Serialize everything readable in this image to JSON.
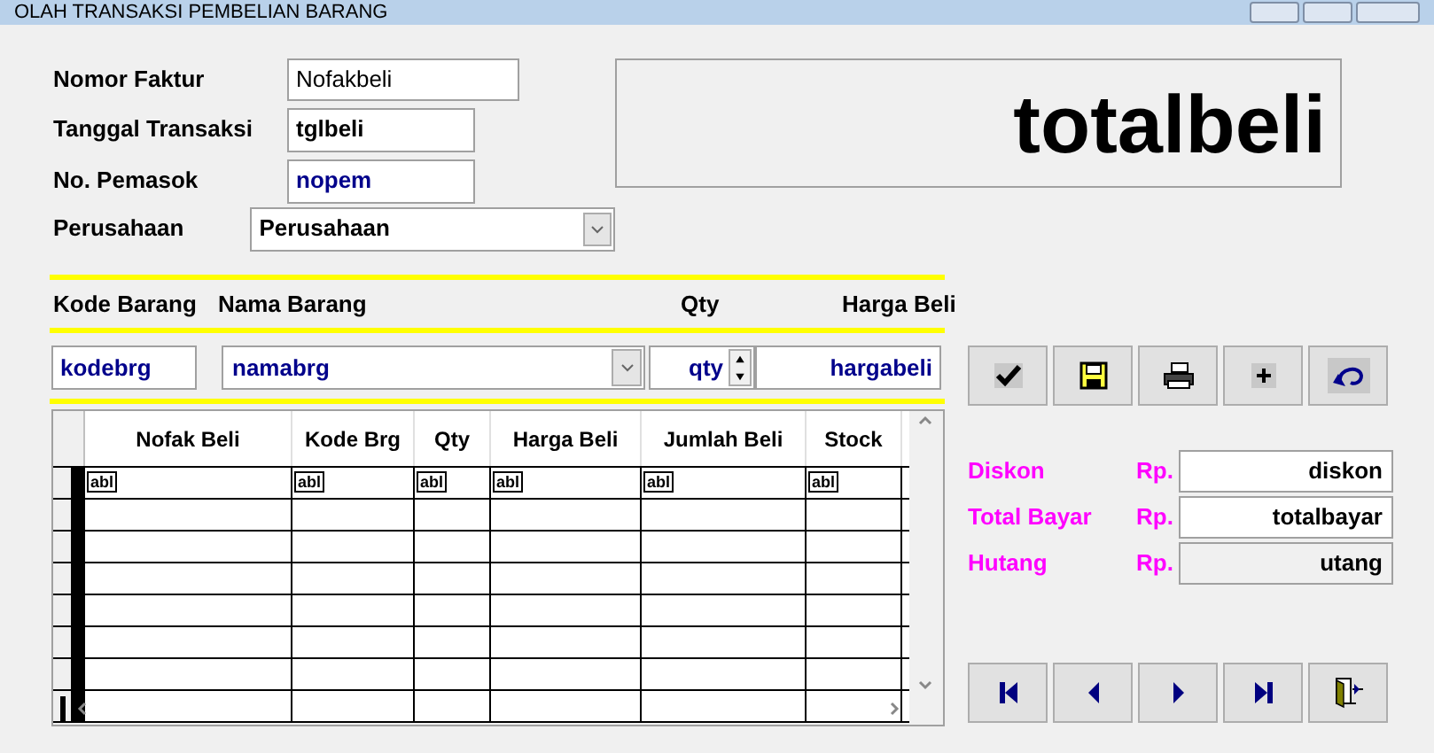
{
  "window": {
    "title": "OLAH TRANSAKSI PEMBELIAN BARANG"
  },
  "header_form": [
    {
      "label": "Nomor Faktur",
      "value": "Nofakbeli",
      "kind": "text"
    },
    {
      "label": "Tanggal Transaksi",
      "value": "tglbeli",
      "kind": "text"
    },
    {
      "label": "No. Pemasok",
      "value": "nopem",
      "kind": "text"
    },
    {
      "label": "Perusahaan",
      "value": "Perusahaan",
      "kind": "combo"
    }
  ],
  "total_display": "totalbeli",
  "item_headers": [
    "Kode Barang",
    "Nama Barang",
    "Qty",
    "Harga Beli"
  ],
  "item_inputs": [
    {
      "value": "kodebrg",
      "kind": "text"
    },
    {
      "value": "namabrg",
      "kind": "combo"
    },
    {
      "value": "qty",
      "kind": "spin"
    },
    {
      "value": "hargabeli",
      "kind": "text"
    }
  ],
  "table": {
    "columns": [
      "Nofak Beli",
      "Kode Brg",
      "Qty",
      "Harga Beli",
      "Jumlah Beli",
      "Stock"
    ],
    "rows": [
      {
        "cells": [
          "abl",
          "abl",
          "abl",
          "abl",
          "abl",
          "abl"
        ]
      }
    ]
  },
  "summary": [
    {
      "label": "Diskon",
      "currency": "Rp.",
      "value": "diskon",
      "disabled": false
    },
    {
      "label": "Total Bayar",
      "currency": "Rp.",
      "value": "totalbayar",
      "disabled": false
    },
    {
      "label": "Hutang",
      "currency": "Rp.",
      "value": "utang",
      "disabled": true
    }
  ]
}
